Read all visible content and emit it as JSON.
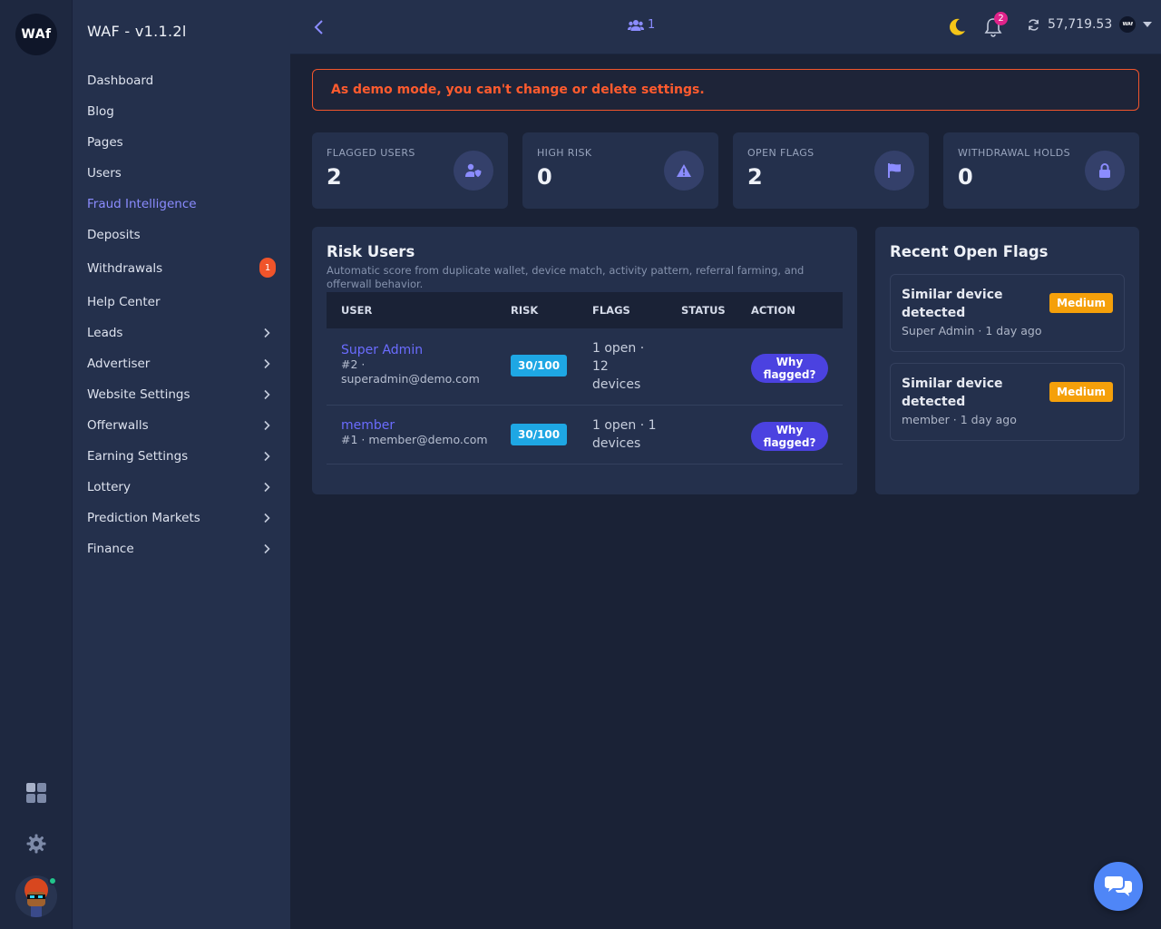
{
  "app": {
    "logo_text": "WAf",
    "brand": "WAF - v1.1.2l"
  },
  "sidebar": {
    "items": [
      {
        "label": "Dashboard"
      },
      {
        "label": "Blog"
      },
      {
        "label": "Pages"
      },
      {
        "label": "Users"
      },
      {
        "label": "Fraud Intelligence"
      },
      {
        "label": "Deposits"
      },
      {
        "label": "Withdrawals",
        "badge": "1"
      },
      {
        "label": "Help Center"
      },
      {
        "label": "Leads"
      },
      {
        "label": "Advertiser"
      },
      {
        "label": "Website Settings"
      },
      {
        "label": "Offerwalls"
      },
      {
        "label": "Earning Settings"
      },
      {
        "label": "Lottery"
      },
      {
        "label": "Prediction Markets"
      },
      {
        "label": "Finance"
      }
    ]
  },
  "topbar": {
    "online_count": "1",
    "notifications": "2",
    "balance": "57,719.53",
    "coin_text": "WAf"
  },
  "alert": {
    "message": "As demo mode, you can't change or delete settings."
  },
  "stats": [
    {
      "label": "FLAGGED USERS",
      "value": "2",
      "icon": "user-shield-icon"
    },
    {
      "label": "HIGH RISK",
      "value": "0",
      "icon": "warning-triangle-icon"
    },
    {
      "label": "OPEN FLAGS",
      "value": "2",
      "icon": "flag-icon"
    },
    {
      "label": "WITHDRAWAL HOLDS",
      "value": "0",
      "icon": "lock-icon"
    }
  ],
  "risk_users": {
    "title": "Risk Users",
    "subtitle": "Automatic score from duplicate wallet, device match, activity pattern, referral farming, and offerwall behavior.",
    "columns": [
      "USER",
      "RISK",
      "FLAGS",
      "STATUS",
      "ACTION"
    ],
    "rows": [
      {
        "name": "Super Admin",
        "meta_line1": "#2 ·",
        "meta_line2": "superadmin@demo.com",
        "risk": "30/100",
        "flags_l1": "1 open ·",
        "flags_l2": "12",
        "flags_l3": "devices",
        "status": "",
        "action_l1": "Why",
        "action_l2": "flagged?"
      },
      {
        "name": "member",
        "meta_line1": "#1 · member@demo.com",
        "meta_line2": "",
        "risk": "30/100",
        "flags_l1": "1 open · 1",
        "flags_l2": "devices",
        "flags_l3": "",
        "status": "",
        "action_l1": "Why",
        "action_l2": "flagged?"
      }
    ]
  },
  "recent_flags": {
    "title": "Recent Open Flags",
    "items": [
      {
        "title_l1": "Similar device",
        "title_l2": "detected",
        "meta": "Super Admin · 1 day ago",
        "severity": "Medium"
      },
      {
        "title_l1": "Similar device",
        "title_l2": "detected",
        "meta": "member · 1 day ago",
        "severity": "Medium"
      }
    ]
  },
  "colors": {
    "accent": "#8b8cff",
    "alert": "#ff5b2e",
    "risk_badge": "#1ea7e4",
    "severity_medium": "#f5a00a",
    "action_button": "#4b42e0"
  }
}
